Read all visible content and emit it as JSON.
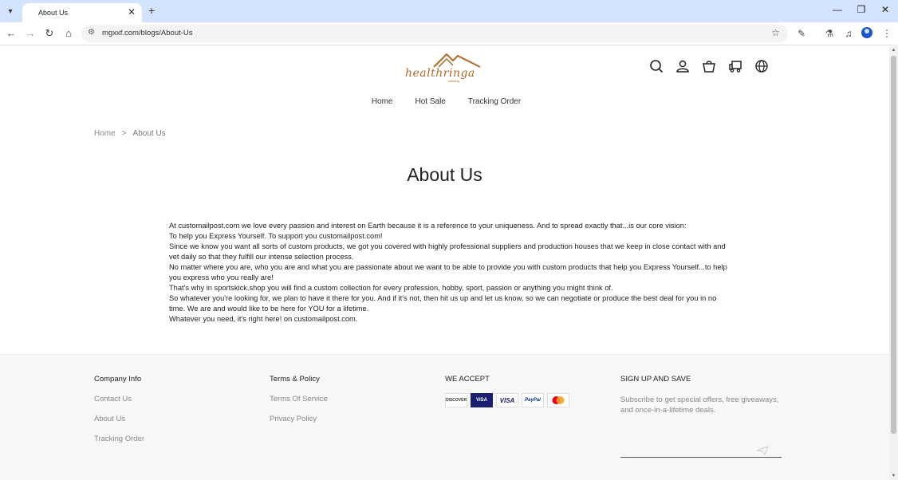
{
  "browser": {
    "tab_title": "About Us",
    "url": "mgxxf.com/blogs/About-Us"
  },
  "header": {
    "logo_text": "healthringa",
    "logo_sub": "clothing"
  },
  "nav": {
    "items": [
      "Home",
      "Hot Sale",
      "Tracking Order"
    ]
  },
  "breadcrumb": {
    "home": "Home",
    "separator": ">",
    "current": "About Us"
  },
  "page": {
    "title": "About Us",
    "paragraphs": [
      "At customailpost.com we love every passion and interest on Earth because it is a reference to your uniqueness. And to spread exactly that...is our core vision:",
      "To help you Express Yourself. To support you customailpost.com!",
      "Since we know you want all sorts of custom products, we got you covered with highly professional suppliers and production houses that we keep in close contact with and vet daily so that they fulfill our intense selection process.",
      "No matter where you are, who you are and what you are passionate about we want to be able to provide you with custom products that help you Express Yourself...to help you express who you really are!",
      "That's why in sportskick.shop you will find a custom collection for every profession, hobby, sport, passion or anything you might think of.",
      "So whatever you're looking for, we plan to have it there for you. And if it's not, then hit us up and let us know, so we can negotiate or produce the best deal for you in no time. We are and would like to be here for YOU for a lifetime.",
      "Whatever you need, it's right here! on customailpost.com."
    ]
  },
  "footer": {
    "company": {
      "heading": "Company Info",
      "links": [
        "Contact Us",
        "About Us",
        "Tracking Order"
      ]
    },
    "terms": {
      "heading": "Terms & Policy",
      "links": [
        "Terms Of Service",
        "Privacy Policy"
      ]
    },
    "accept": {
      "heading": "WE ACCEPT",
      "cards": [
        "DISCOVER",
        "VISA",
        "VISA",
        "PayPal",
        "mastercard"
      ]
    },
    "signup": {
      "heading": "SIGN UP AND SAVE",
      "text": "Subscribe to get special offers, free giveaways, and once-in-a-lifetime deals.",
      "placeholder": ""
    }
  },
  "colors": {
    "brand": "#b06a2a",
    "chrome": "#d3e3fd",
    "footer_bg": "#f7f7f7"
  }
}
